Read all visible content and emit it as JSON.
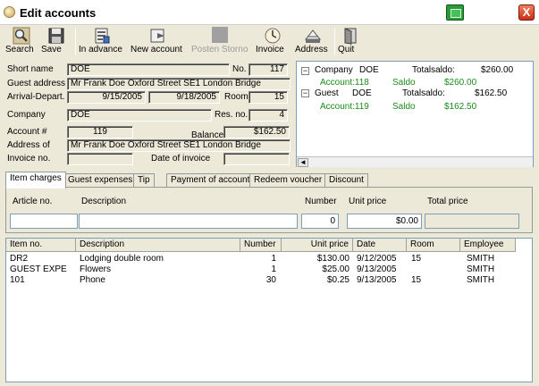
{
  "window": {
    "title": "Edit accounts",
    "close_label": "X"
  },
  "toolbar": [
    {
      "label": "Search",
      "icon": "search-icon"
    },
    {
      "label": "Save",
      "icon": "save-icon"
    },
    {
      "label": "In advance",
      "icon": "in-advance-icon"
    },
    {
      "label": "New account",
      "icon": "new-account-icon"
    },
    {
      "label": "Posten Storno",
      "icon": "storno-icon",
      "disabled": true
    },
    {
      "label": "Invoice",
      "icon": "invoice-icon"
    },
    {
      "label": "Address",
      "icon": "address-icon"
    },
    {
      "label": "Quit",
      "icon": "quit-icon"
    }
  ],
  "form": {
    "short_name_label": "Short name",
    "short_name": "DOE",
    "no_label": "No.",
    "no": "117",
    "guest_address_label": "Guest address",
    "guest_address": "Mr Frank Doe Oxford Street SE1 London Bridge",
    "arrival_label": "Arrival-Depart.",
    "arrival": "9/15/2005",
    "departure": "9/18/2005",
    "room_label": "Room",
    "room": "15",
    "company_label": "Company",
    "company": "DOE",
    "res_no_label": "Res. no.",
    "res_no": "4",
    "account_label": "Account #",
    "account": "119",
    "balance_label": "Balance",
    "balance": "$162.50",
    "address_of_label": "Address of",
    "address_of": "Mr Frank Doe Oxford Street SE1 London Bridge",
    "invoice_no_label": "Invoice no.",
    "invoice_no": "",
    "date_of_invoice_label": "Date of invoice",
    "date_of_invoice": ""
  },
  "tree": {
    "company": {
      "type": "Company",
      "name": "DOE",
      "total_label": "Totalsaldo:",
      "total": "$260.00"
    },
    "company_child": {
      "account": "Account:118",
      "saldo_label": "Saldo",
      "saldo": "$260.00"
    },
    "guest": {
      "type": "Guest",
      "name": "DOE",
      "total_label": "Totalsaldo:",
      "total": "$162.50"
    },
    "guest_child": {
      "account": "Account:119",
      "saldo_label": "Saldo",
      "saldo": "$162.50"
    },
    "expand_symbol": "−",
    "scroll_left": "◄"
  },
  "tabs": [
    "Item charges",
    "Guest expenses",
    "Tip",
    "Payment of account",
    "Redeem voucher",
    "Discount"
  ],
  "entry": {
    "article_label": "Article no.",
    "description_label": "Description",
    "number_label": "Number",
    "unit_price_label": "Unit price",
    "total_price_label": "Total price",
    "article": "",
    "description": "",
    "number": "0",
    "unit_price": "$0.00",
    "total_price": ""
  },
  "grid": {
    "headers": [
      "Item no.",
      "Description",
      "Number",
      "Unit price",
      "Date",
      "Room",
      "Employee"
    ],
    "rows": [
      [
        "DR2",
        "Lodging double room",
        "1",
        "$130.00",
        "9/12/2005",
        "15",
        "SMITH"
      ],
      [
        "GUEST EXPE",
        "Flowers",
        "1",
        "$25.00",
        "9/13/2005",
        "",
        "SMITH"
      ],
      [
        "101",
        "Phone",
        "30",
        "$0.25",
        "9/13/2005",
        "15",
        "SMITH"
      ]
    ]
  },
  "colors": {
    "window_bg": "#ECE9D8",
    "tree_green": "#1a8a1a",
    "title_green_button": "#2a9a3a",
    "close_red": "#c83018"
  }
}
